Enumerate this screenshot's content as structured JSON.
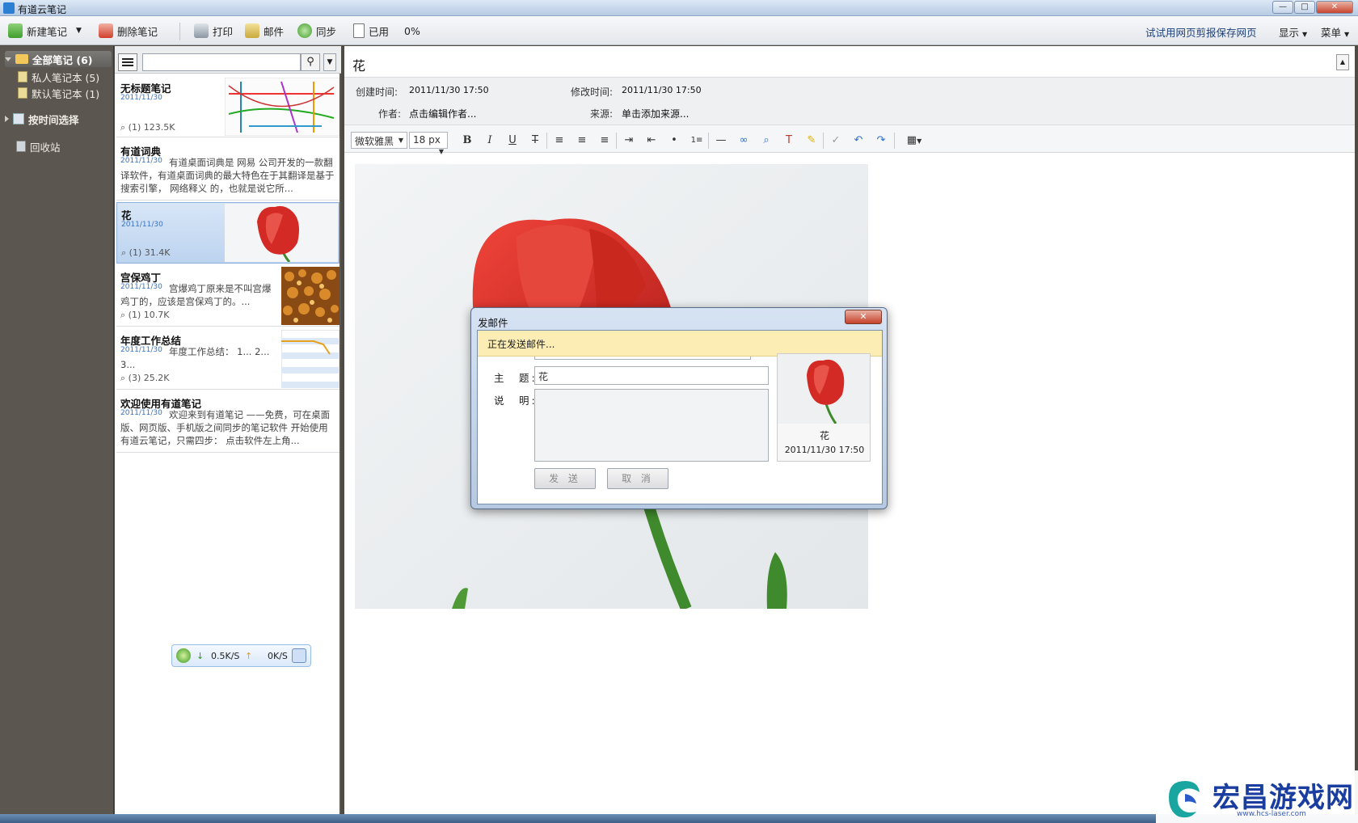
{
  "window": {
    "title": "有道云笔记",
    "controls": [
      "minimize",
      "maximize",
      "close"
    ]
  },
  "toolbar": {
    "new_note": "新建笔记",
    "delete_note": "删除笔记",
    "print": "打印",
    "mail": "邮件",
    "sync": "同步",
    "used": "已用",
    "used_percent": "0%",
    "web_clip": "试试用网页剪报保存网页",
    "display": "显示",
    "menu": "菜单"
  },
  "sidebar": {
    "all_notes": "全部笔记 (6)",
    "notebooks": [
      {
        "label": "私人笔记本 (5)"
      },
      {
        "label": "默认笔记本 (1)"
      }
    ],
    "by_time": "按时间选择",
    "trash": "回收站"
  },
  "search": {
    "placeholder": ""
  },
  "notes": [
    {
      "title": "无标题笔记",
      "date": "2011/11/30",
      "excerpt": "",
      "meta": "(1) 123.5K",
      "thumb": "subway-map"
    },
    {
      "title": "有道词典",
      "date": "2011/11/30",
      "excerpt": "有道桌面词典是 网易 公司开发的一款翻译软件，有道桌面词典的最大特色在于其翻译是基于搜索引擎， 网络释义 的，也就是说它所...",
      "meta": "",
      "thumb": ""
    },
    {
      "title": "花",
      "date": "2011/11/30",
      "excerpt": "",
      "meta": "(1) 31.4K",
      "thumb": "tulip"
    },
    {
      "title": "宫保鸡丁",
      "date": "2011/11/30",
      "excerpt": "宫爆鸡丁原来是不叫宫爆鸡丁的，应该是宫保鸡丁的。...",
      "meta": "(1) 10.7K",
      "thumb": "food"
    },
    {
      "title": "年度工作总结",
      "date": "2011/11/30",
      "excerpt": "年度工作总结： 1... 2... 3...",
      "meta": "(3) 25.2K",
      "thumb": "sheet"
    },
    {
      "title": "欢迎使用有道笔记",
      "date": "2011/11/30",
      "excerpt": "欢迎来到有道笔记 ——免费，可在桌面版、网页版、手机版之间同步的笔记软件 开始使用有道云笔记，只需四步： 点击软件左上角...",
      "meta": "",
      "thumb": ""
    }
  ],
  "note_view": {
    "title": "花",
    "created_label": "创建时间:",
    "created": "2011/11/30 17:50",
    "modified_label": "修改时间:",
    "modified": "2011/11/30 17:50",
    "author_label": "作者:",
    "author": "点击编辑作者...",
    "source_label": "来源:",
    "source": "单击添加来源..."
  },
  "format_bar": {
    "font": "微软雅黑",
    "size": "18 px",
    "bold": "B",
    "italic": "I",
    "underline": "U",
    "strike": "T"
  },
  "mail_dialog": {
    "title": "发邮件",
    "status": "正在发送邮件...",
    "subject_label": "主　题:",
    "subject_value": "花",
    "desc_label": "说　明:",
    "send": "发 送",
    "cancel": "取 消",
    "preview_title": "花",
    "preview_date": "2011/11/30 17:50"
  },
  "speed_widget": {
    "down": "0.5K/S",
    "up": "0K/S"
  },
  "watermark": {
    "text": "宏昌游戏网",
    "url": "www.hcs-laser.com"
  }
}
